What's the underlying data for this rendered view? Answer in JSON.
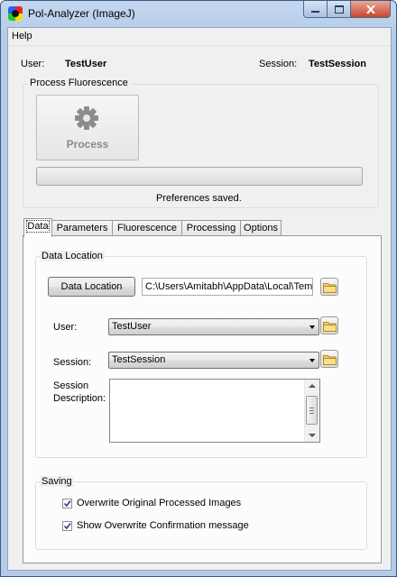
{
  "window": {
    "title": "Pol-Analyzer (ImageJ)"
  },
  "menu": {
    "help": "Help"
  },
  "header": {
    "user_label": "User:",
    "user_value": "TestUser",
    "session_label": "Session:",
    "session_value": "TestSession"
  },
  "process_group": {
    "title": "Process Fluorescence",
    "button_label": "Process",
    "progress": 0,
    "status": "Preferences saved."
  },
  "tabs": [
    {
      "label": "Data"
    },
    {
      "label": "Parameters"
    },
    {
      "label": "Fluorescence"
    },
    {
      "label": "Processing"
    },
    {
      "label": "Options"
    }
  ],
  "data_tab": {
    "location_group_title": "Data Location",
    "data_location_button": "Data Location",
    "data_location_path": "C:\\Users\\Amitabh\\AppData\\Local\\Temp",
    "user_label": "User:",
    "user_selected": "TestUser",
    "session_label": "Session:",
    "session_selected": "TestSession",
    "description_label_1": "Session",
    "description_label_2": "Description:",
    "description_value": "",
    "saving_group_title": "Saving",
    "overwrite_images_label": "Overwrite Original Processed Images",
    "overwrite_images_checked": true,
    "show_confirm_label": "Show Overwrite Confirmation message",
    "show_confirm_checked": true
  },
  "icons": {
    "app": "app-icon",
    "minimize": "minimize-icon",
    "maximize": "maximize-icon",
    "close": "close-icon",
    "gear": "gear-icon",
    "folder": "folder-icon",
    "dropdown": "chevron-down-icon",
    "check": "check-icon"
  },
  "colors": {
    "progress_fill": "#06b025",
    "folder": "#f3d36b"
  }
}
